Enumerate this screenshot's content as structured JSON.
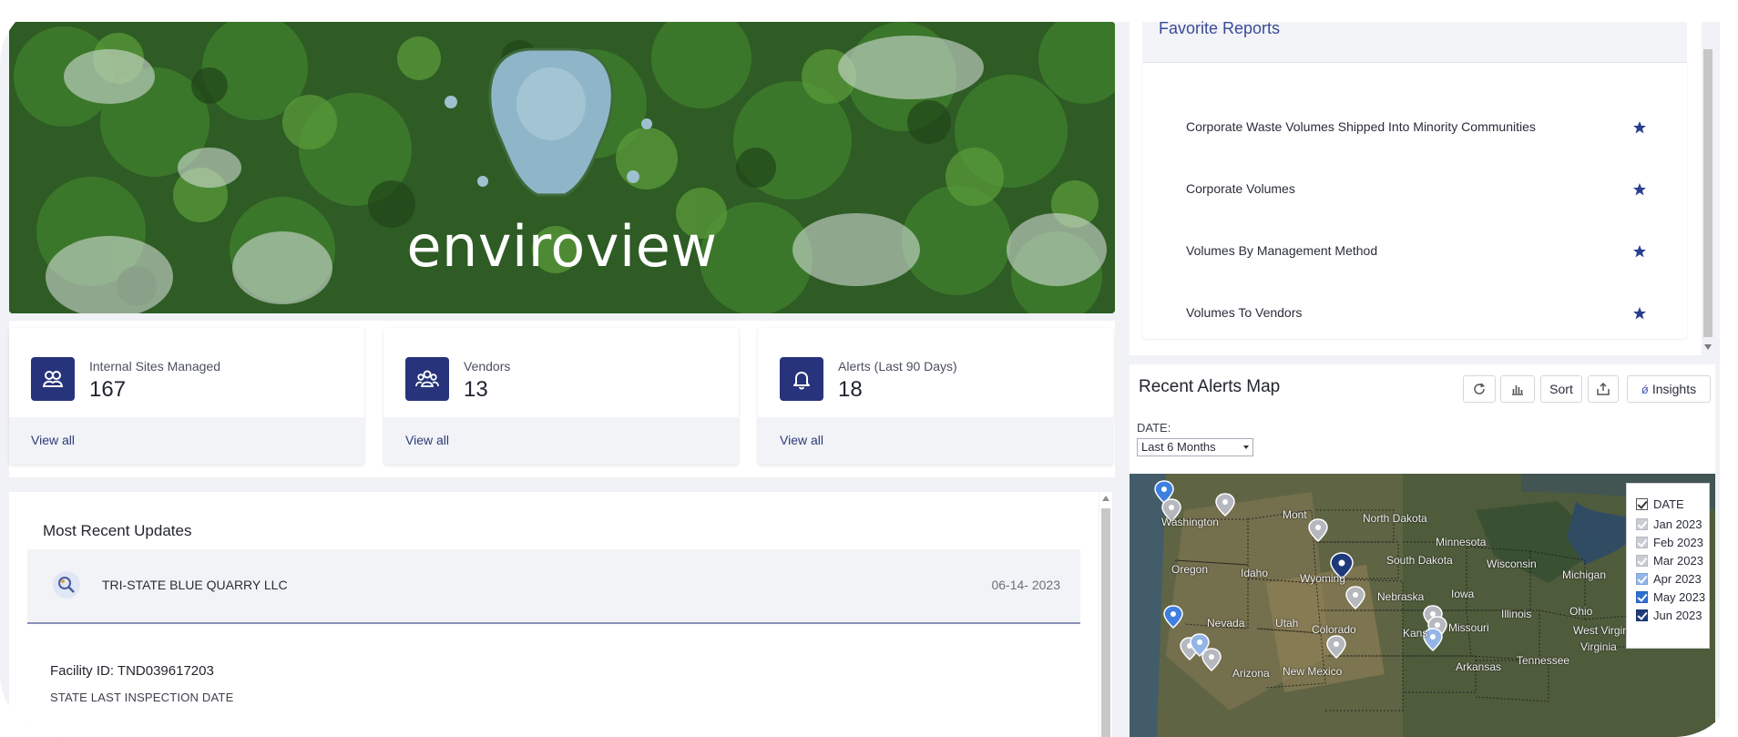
{
  "hero": {
    "title": "enviroview"
  },
  "stats": [
    {
      "label": "Internal Sites Managed",
      "value": "167",
      "link": "View all",
      "icon": "users-icon"
    },
    {
      "label": "Vendors",
      "value": "13",
      "link": "View all",
      "icon": "group-icon"
    },
    {
      "label": "Alerts (Last 90 Days)",
      "value": "18",
      "link": "View all",
      "icon": "bell-icon"
    }
  ],
  "updates": {
    "title": "Most Recent Updates",
    "row": {
      "name": "TRI-STATE BLUE QUARRY LLC",
      "date": "06-14- 2023"
    },
    "facility_id": "Facility ID: TND039617203",
    "inspection_label": "STATE LAST INSPECTION DATE"
  },
  "favorites": {
    "title": "Favorite Reports",
    "items": [
      "Corporate Waste Volumes Shipped Into Minority Communities",
      "Corporate Volumes",
      "Volumes By Management Method",
      "Volumes To Vendors"
    ]
  },
  "alerts_map": {
    "title": "Recent Alerts Map",
    "toolbar": {
      "refresh_icon": "refresh-icon",
      "chart_icon": "bar-chart-icon",
      "sort": "Sort",
      "export_icon": "export-icon",
      "insights": "Insights"
    },
    "date_label": "DATE:",
    "date_value": "Last 6 Months",
    "legend": {
      "header": "DATE",
      "items": [
        "Jan 2023",
        "Feb 2023",
        "Mar 2023",
        "Apr 2023",
        "May 2023",
        "Jun 2023"
      ]
    },
    "labels": [
      "Washington",
      "Mont",
      "North Dakota",
      "Minnesota",
      "Oregon",
      "Idaho",
      "Wyoming",
      "South Dakota",
      "Wisconsin",
      "Michigan",
      "Nebraska",
      "Iowa",
      "Nevada",
      "Utah",
      "Colorado",
      "Illinois",
      "Ohio",
      "Kans",
      "Missouri",
      "West Virginia",
      "Virginia",
      "Tennessee",
      "Arkansas",
      "Arizona",
      "New Mexico"
    ]
  },
  "colors": {
    "primary": "#27337a",
    "accent": "#3a4a9a",
    "pin_gray": "#b5b8be",
    "pin_blue": "#3f7fe0",
    "pin_dark": "#1e3a7a"
  }
}
